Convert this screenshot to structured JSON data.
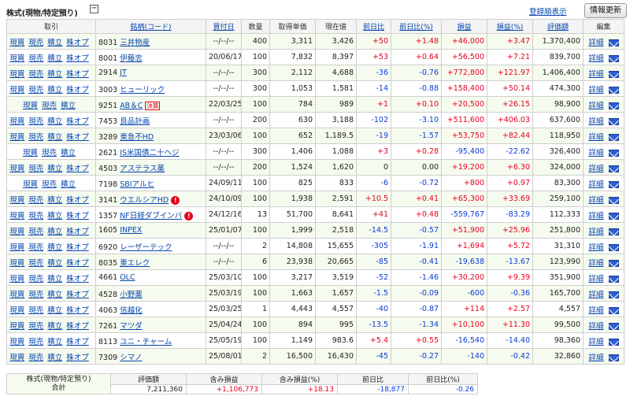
{
  "header": {
    "title": "株式(現物/特定預り)",
    "collapse_symbol": "−",
    "register_link": "登録順表示",
    "refresh_button": "情報更新"
  },
  "columns": [
    "取引",
    "銘柄(コード)",
    "買付日",
    "数量",
    "取得単価",
    "現在値",
    "前日比",
    "前日比(%)",
    "損益",
    "損益(%)",
    "評価額",
    "編集"
  ],
  "link_labels": {
    "buy": "現買",
    "sell": "現売",
    "reserve": "積立",
    "option": "株オプ",
    "detail": "詳細"
  },
  "rows": [
    {
      "code": "8031",
      "name": "三井物産",
      "date": "--/--/--",
      "qty": "400",
      "cost": "3,311",
      "price": "3,426",
      "chg": "+50",
      "chg_pct": "+1.48",
      "pl": "+46,000",
      "pl_pct": "+3.47",
      "value": "1,370,400",
      "opt": true,
      "badge": "",
      "alert": false
    },
    {
      "code": "8001",
      "name": "伊藤忠",
      "date": "20/06/17",
      "qty": "100",
      "cost": "7,832",
      "price": "8,397",
      "chg": "+53",
      "chg_pct": "+0.64",
      "pl": "+56,500",
      "pl_pct": "+7.21",
      "value": "839,700",
      "opt": true,
      "badge": "",
      "alert": false
    },
    {
      "code": "2914",
      "name": "JT",
      "date": "--/--/--",
      "qty": "300",
      "cost": "2,112",
      "price": "4,688",
      "chg": "-36",
      "chg_pct": "-0.76",
      "pl": "+772,800",
      "pl_pct": "+121.97",
      "value": "1,406,400",
      "opt": true,
      "badge": "",
      "alert": false
    },
    {
      "code": "3003",
      "name": "ヒューリック",
      "date": "--/--/--",
      "qty": "300",
      "cost": "1,053",
      "price": "1,581",
      "chg": "-14",
      "chg_pct": "-0.88",
      "pl": "+158,400",
      "pl_pct": "+50.14",
      "value": "474,300",
      "opt": true,
      "badge": "",
      "alert": false
    },
    {
      "code": "9251",
      "name": "AB＆C",
      "date": "22/03/25",
      "qty": "100",
      "cost": "784",
      "price": "989",
      "chg": "+1",
      "chg_pct": "+0.10",
      "pl": "+20,500",
      "pl_pct": "+26.15",
      "value": "98,900",
      "opt": false,
      "badge": "決算",
      "alert": false
    },
    {
      "code": "7453",
      "name": "良品計画",
      "date": "--/--/--",
      "qty": "200",
      "cost": "630",
      "price": "3,188",
      "chg": "-102",
      "chg_pct": "-3.10",
      "pl": "+511,600",
      "pl_pct": "+406.03",
      "value": "637,600",
      "opt": true,
      "badge": "",
      "alert": false
    },
    {
      "code": "3289",
      "name": "東急不HD",
      "date": "23/03/06",
      "qty": "100",
      "cost": "652",
      "price": "1,189.5",
      "chg": "-19",
      "chg_pct": "-1.57",
      "pl": "+53,750",
      "pl_pct": "+82.44",
      "value": "118,950",
      "opt": true,
      "badge": "",
      "alert": false
    },
    {
      "code": "2621",
      "name": "IS米国債二十ヘジ",
      "date": "--/--/--",
      "qty": "300",
      "cost": "1,406",
      "price": "1,088",
      "chg": "+3",
      "chg_pct": "+0.28",
      "pl": "-95,400",
      "pl_pct": "-22.62",
      "value": "326,400",
      "opt": false,
      "badge": "",
      "alert": false
    },
    {
      "code": "4503",
      "name": "アステラス薬",
      "date": "--/--/--",
      "qty": "200",
      "cost": "1,524",
      "price": "1,620",
      "chg": "0",
      "chg_pct": "0.00",
      "pl": "+19,200",
      "pl_pct": "+6.30",
      "value": "324,000",
      "opt": true,
      "badge": "",
      "alert": false
    },
    {
      "code": "7198",
      "name": "SBIアルヒ",
      "date": "24/09/11",
      "qty": "100",
      "cost": "825",
      "price": "833",
      "chg": "-6",
      "chg_pct": "-0.72",
      "pl": "+800",
      "pl_pct": "+0.97",
      "value": "83,300",
      "opt": false,
      "badge": "",
      "alert": false
    },
    {
      "code": "3141",
      "name": "ウエルシアHD",
      "date": "24/10/09",
      "qty": "100",
      "cost": "1,938",
      "price": "2,591",
      "chg": "+10.5",
      "chg_pct": "+0.41",
      "pl": "+65,300",
      "pl_pct": "+33.69",
      "value": "259,100",
      "opt": true,
      "badge": "",
      "alert": true
    },
    {
      "code": "1357",
      "name": "NF日経ダブインバ",
      "date": "24/12/16",
      "qty": "13",
      "cost": "51,700",
      "price": "8,641",
      "chg": "+41",
      "chg_pct": "+0.48",
      "pl": "-559,767",
      "pl_pct": "-83.29",
      "value": "112,333",
      "opt": true,
      "badge": "",
      "alert": true
    },
    {
      "code": "1605",
      "name": "INPEX",
      "date": "25/01/07",
      "qty": "100",
      "cost": "1,999",
      "price": "2,518",
      "chg": "-14.5",
      "chg_pct": "-0.57",
      "pl": "+51,900",
      "pl_pct": "+25.96",
      "value": "251,800",
      "opt": true,
      "badge": "",
      "alert": false
    },
    {
      "code": "6920",
      "name": "レーザーテック",
      "date": "--/--/--",
      "qty": "2",
      "cost": "14,808",
      "price": "15,655",
      "chg": "-305",
      "chg_pct": "-1.91",
      "pl": "+1,694",
      "pl_pct": "+5.72",
      "value": "31,310",
      "opt": true,
      "badge": "",
      "alert": false
    },
    {
      "code": "8035",
      "name": "東エレク",
      "date": "--/--/--",
      "qty": "6",
      "cost": "23,938",
      "price": "20,665",
      "chg": "-85",
      "chg_pct": "-0.41",
      "pl": "-19,638",
      "pl_pct": "-13.67",
      "value": "123,990",
      "opt": true,
      "badge": "",
      "alert": false
    },
    {
      "code": "4661",
      "name": "OLC",
      "date": "25/03/10",
      "qty": "100",
      "cost": "3,217",
      "price": "3,519",
      "chg": "-52",
      "chg_pct": "-1.46",
      "pl": "+30,200",
      "pl_pct": "+9.39",
      "value": "351,900",
      "opt": true,
      "badge": "",
      "alert": false
    },
    {
      "code": "4528",
      "name": "小野薬",
      "date": "25/03/19",
      "qty": "100",
      "cost": "1,663",
      "price": "1,657",
      "chg": "-1.5",
      "chg_pct": "-0.09",
      "pl": "-600",
      "pl_pct": "-0.36",
      "value": "165,700",
      "opt": true,
      "badge": "",
      "alert": false
    },
    {
      "code": "4063",
      "name": "信越化",
      "date": "25/03/25",
      "qty": "1",
      "cost": "4,443",
      "price": "4,557",
      "chg": "-40",
      "chg_pct": "-0.87",
      "pl": "+114",
      "pl_pct": "+2.57",
      "value": "4,557",
      "opt": true,
      "badge": "",
      "alert": false
    },
    {
      "code": "7261",
      "name": "マツダ",
      "date": "25/04/24",
      "qty": "100",
      "cost": "894",
      "price": "995",
      "chg": "-13.5",
      "chg_pct": "-1.34",
      "pl": "+10,100",
      "pl_pct": "+11.30",
      "value": "99,500",
      "opt": true,
      "badge": "",
      "alert": false
    },
    {
      "code": "8113",
      "name": "ユニ・チャーム",
      "date": "25/05/19",
      "qty": "100",
      "cost": "1,149",
      "price": "983.6",
      "chg": "+5.4",
      "chg_pct": "+0.55",
      "pl": "-16,540",
      "pl_pct": "-14.40",
      "value": "98,360",
      "opt": true,
      "badge": "",
      "alert": false
    },
    {
      "code": "7309",
      "name": "シマノ",
      "date": "25/08/01",
      "qty": "2",
      "cost": "16,500",
      "price": "16,430",
      "chg": "-45",
      "chg_pct": "-0.27",
      "pl": "-140",
      "pl_pct": "-0.42",
      "value": "32,860",
      "opt": true,
      "badge": "",
      "alert": false
    }
  ],
  "summary": {
    "label_line1": "株式(現物/特定預り)",
    "label_line2": "合計",
    "headers": [
      "評価額",
      "含み損益",
      "含み損益(%)",
      "前日比",
      "前日比(%)"
    ],
    "values": [
      "7,211,360",
      "+1,106,773",
      "+18.13",
      "-18,877",
      "-0.26"
    ]
  },
  "colors": {
    "positive": "#e8001c",
    "negative": "#0a3ad6",
    "link": "#0645ad",
    "row_alt": "#f6fbef"
  }
}
